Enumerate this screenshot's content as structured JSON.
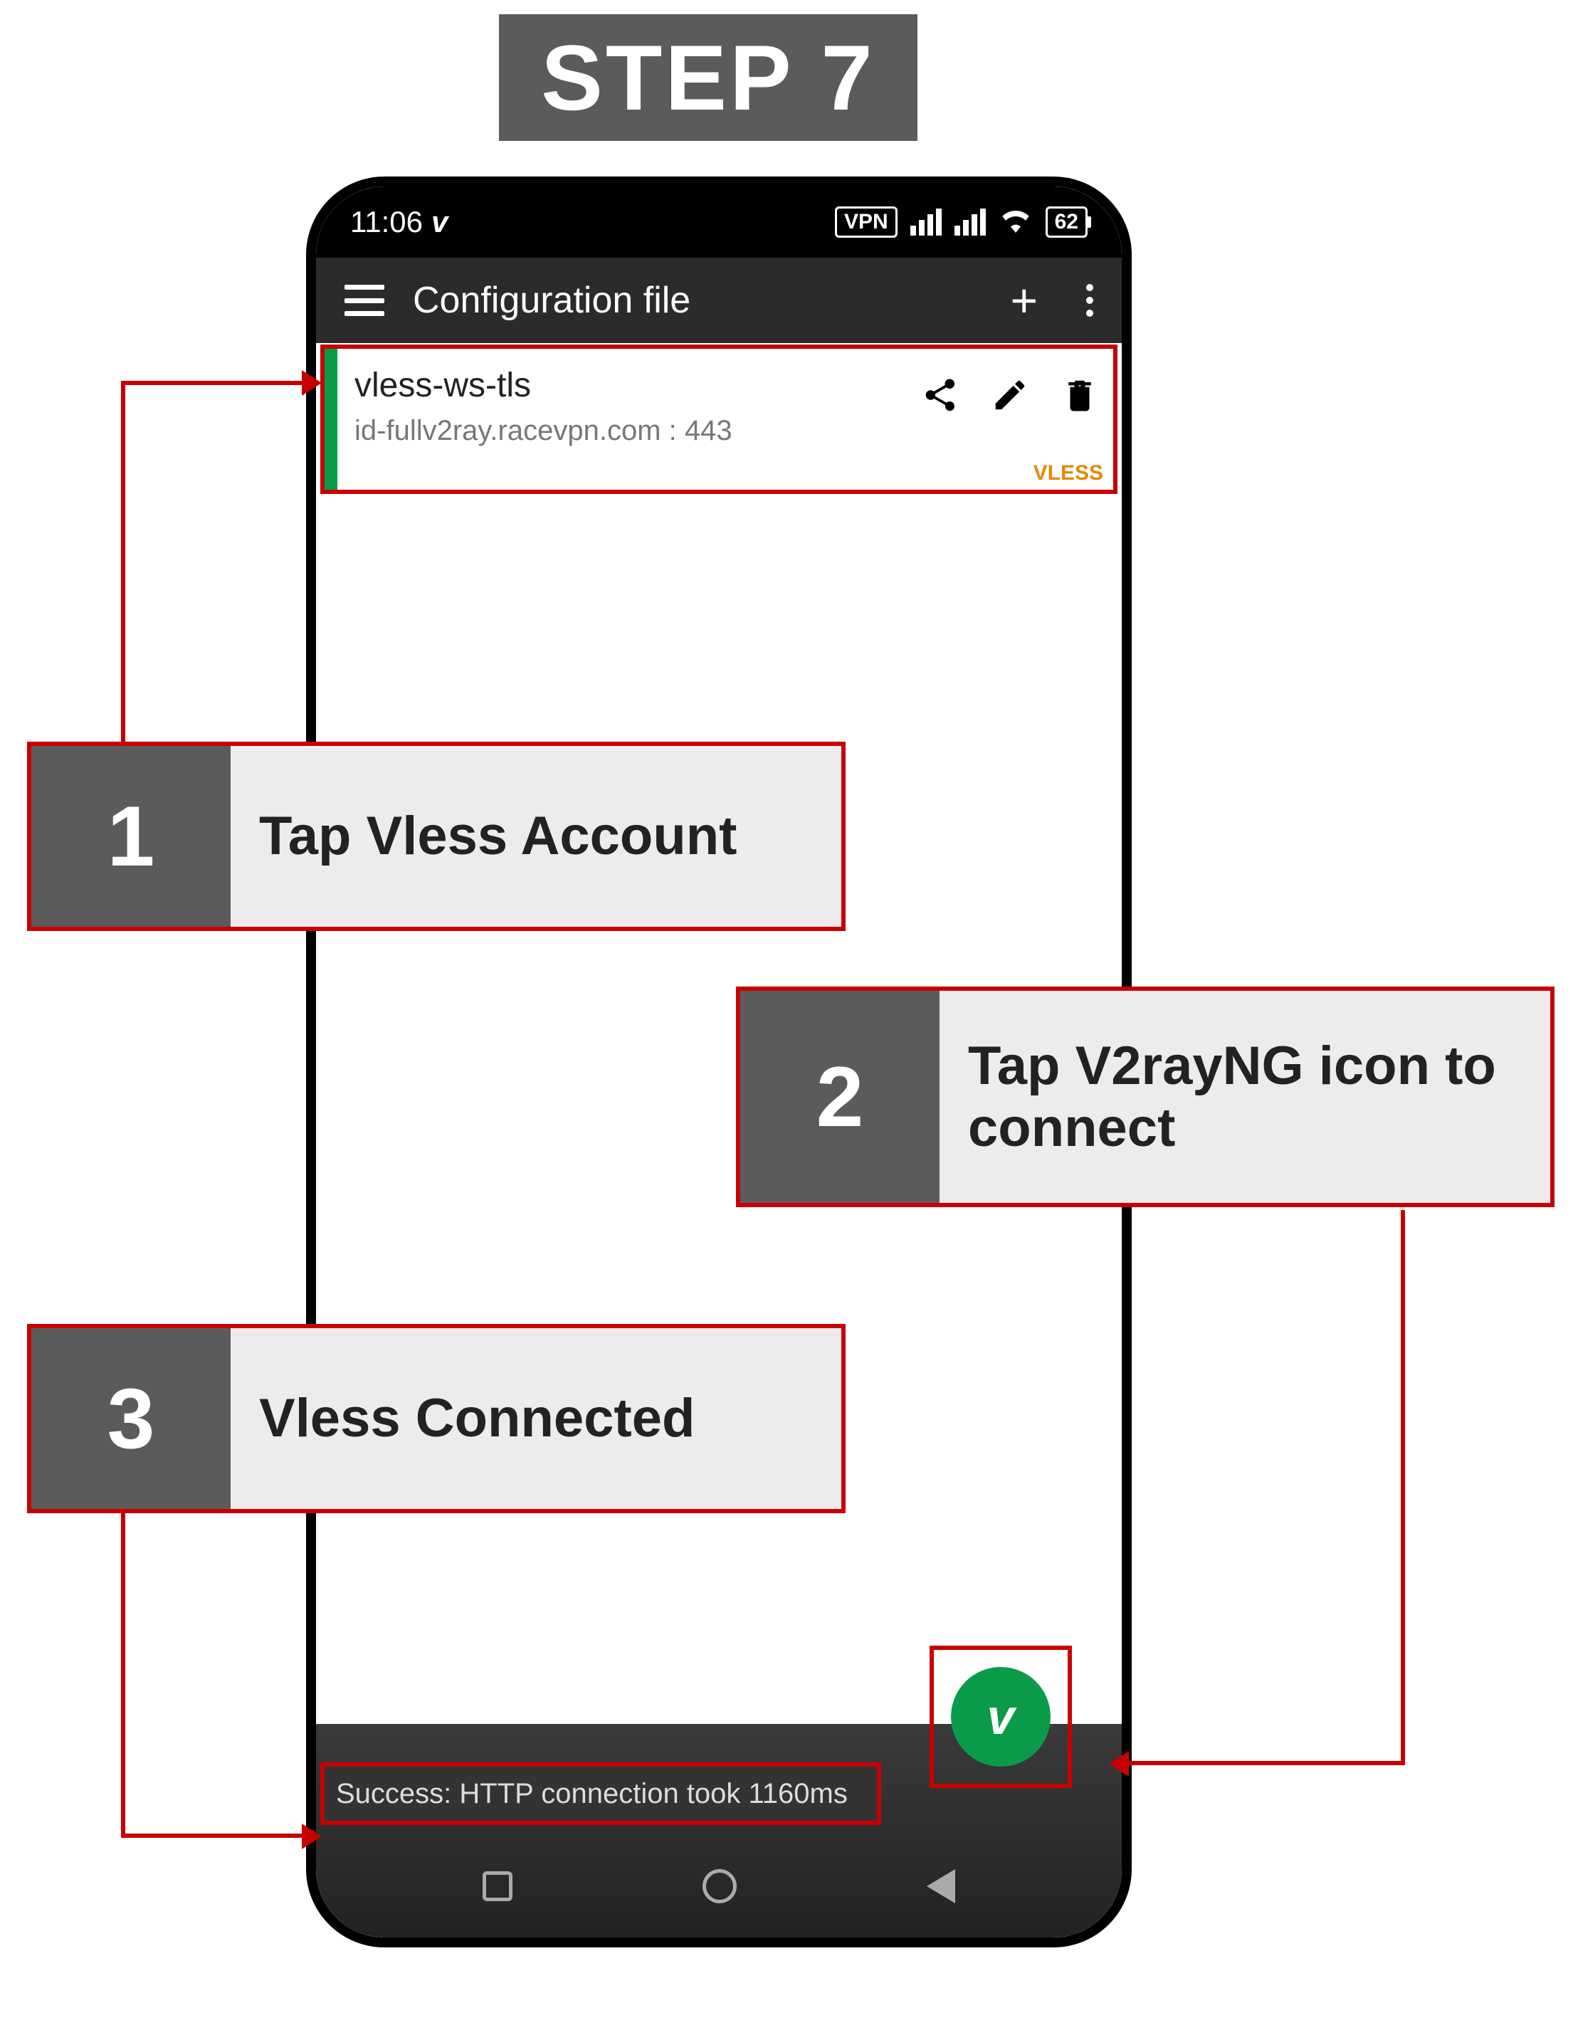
{
  "step_banner": "STEP 7",
  "status": {
    "time": "11:06",
    "vpn_label": "VPN",
    "battery": "62"
  },
  "app_bar": {
    "title": "Configuration file"
  },
  "config": {
    "name": "vless-ws-tls",
    "host": "id-fullv2ray.racevpn.com : 443",
    "protocol": "VLESS"
  },
  "success_text": "Success: HTTP connection took 1160ms",
  "fab": {
    "glyph": "v"
  },
  "callouts": [
    {
      "num": "1",
      "text": "Tap Vless Account"
    },
    {
      "num": "2",
      "text": "Tap V2rayNG icon to connect"
    },
    {
      "num": "3",
      "text": "Vless Connected"
    }
  ]
}
